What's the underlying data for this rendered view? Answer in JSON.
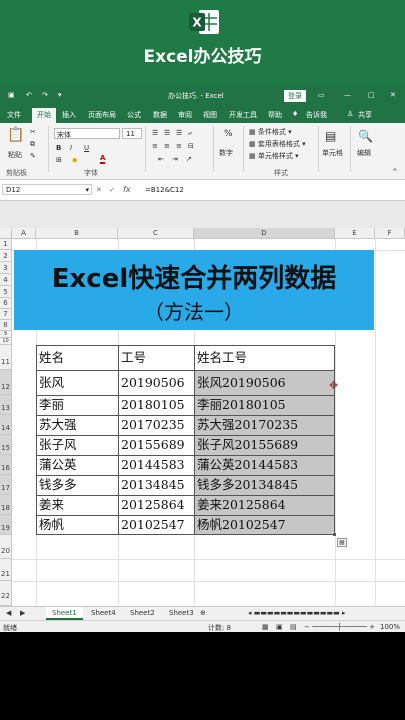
{
  "brand": {
    "title": "Excel办公技巧",
    "logo_letter": "X"
  },
  "titlebar": {
    "doc_title": "办公技巧. - Excel",
    "login": "登录",
    "minimize": "—",
    "restore": "□",
    "close": "✕"
  },
  "tabs": [
    "文件",
    "开始",
    "插入",
    "页面布局",
    "公式",
    "数据",
    "审阅",
    "视图",
    "开发工具",
    "帮助",
    "告诉我",
    "共享"
  ],
  "ribbon": {
    "paste": "粘贴",
    "clipboard": "剪贴板",
    "font_name": "宋体",
    "font_size": "11",
    "bold": "B",
    "italic": "I",
    "underline": "U",
    "font_group": "字体",
    "align_group": "对齐方式",
    "number": "数字",
    "number_symbol": "%",
    "cond_format": "条件格式 ▾",
    "table_format": "套用表格格式 ▾",
    "cell_style": "单元格样式 ▾",
    "style_group": "样式",
    "cells": "单元格",
    "editing": "编辑"
  },
  "formula_bar": {
    "name_box": "D12",
    "formula": "=B12&C12",
    "fx": "fx",
    "cancel": "✕",
    "confirm": "✓"
  },
  "columns": [
    "A",
    "B",
    "C",
    "D",
    "E",
    "F"
  ],
  "rows": [
    "1",
    "2",
    "3",
    "4",
    "5",
    "6",
    "7",
    "8",
    "9",
    "10",
    "11",
    "12",
    "13",
    "14",
    "15",
    "16",
    "17",
    "18",
    "19",
    "20",
    "21",
    "22"
  ],
  "banner": {
    "title": "Excel快速合并两列数据",
    "subtitle": "（方法一）"
  },
  "table": {
    "headers": [
      "姓名",
      "工号",
      "姓名工号"
    ],
    "rows": [
      [
        "张风",
        "20190506",
        "张风20190506"
      ],
      [
        "李丽",
        "20180105",
        "李丽20180105"
      ],
      [
        "苏大强",
        "20170235",
        "苏大强20170235"
      ],
      [
        "张子风",
        "20155689",
        "张子风20155689"
      ],
      [
        "蒲公英",
        "20144583",
        "蒲公英20144583"
      ],
      [
        "钱多多",
        "20134845",
        "钱多多20134845"
      ],
      [
        "姜来",
        "20125864",
        "姜来20125864"
      ],
      [
        "杨帆",
        "20102547",
        "杨帆20102547"
      ]
    ]
  },
  "sheet_tabs": [
    "Sheet1",
    "Sheet4",
    "Sheet2",
    "Sheet3"
  ],
  "status": {
    "ready": "就绪",
    "count": "计数: 8",
    "zoom": "100%"
  },
  "colors": {
    "brand_green": "#1f7a45",
    "excel_green": "#217346",
    "banner_blue": "#29a9e8",
    "selection": "#c6c6c6"
  }
}
